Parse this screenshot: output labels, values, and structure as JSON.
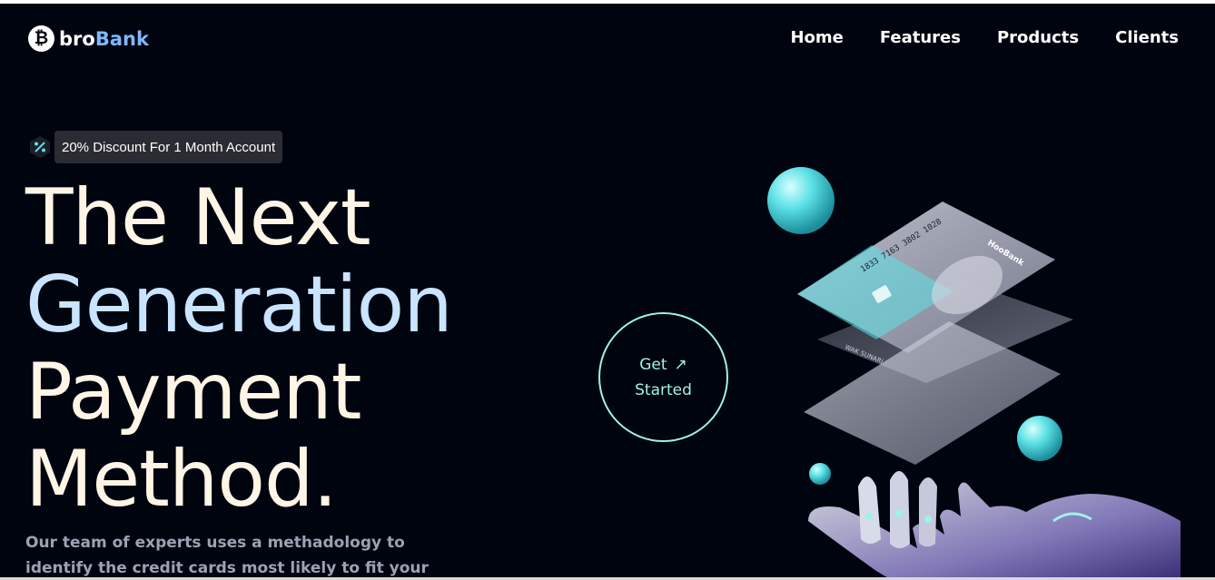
{
  "brand": {
    "prefix": "bro",
    "suffix": "Bank",
    "logo_icon": "bitcoin-icon"
  },
  "nav": {
    "items": [
      "Home",
      "Features",
      "Products",
      "Clients"
    ]
  },
  "discount": {
    "label": "20% Discount For 1 Month Account",
    "icon": "percent-icon"
  },
  "headline": {
    "line1": "The Next",
    "line2": "Generation",
    "line3": "Payment",
    "line4": "Method."
  },
  "description": "Our team of experts uses a methadology to identify the credit cards most likely to fit your needs.We",
  "cta": {
    "line1": "Get",
    "line2": "Started",
    "arrow": "↗"
  },
  "card": {
    "number": "1833 7163 3802 1028",
    "holder": "WAK SUNARI",
    "brand": "HooBank"
  },
  "colors": {
    "background": "#00040f",
    "accent": "#5ce1e6",
    "headline_warm": "#fff5e6",
    "headline_cool": "#c9e4ff",
    "pill": "#2b2b33"
  }
}
